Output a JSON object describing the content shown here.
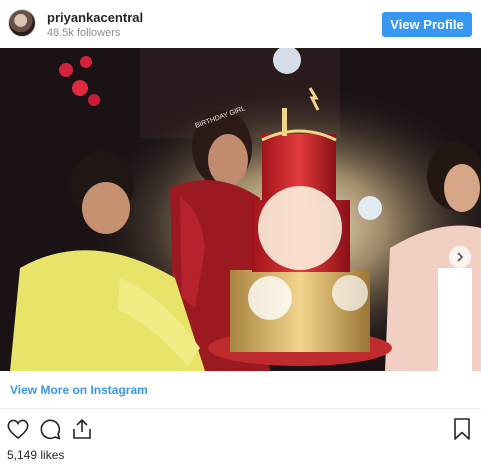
{
  "header": {
    "username": "priyankacentral",
    "followers": "48.5k followers",
    "view_profile_label": "View Profile"
  },
  "photo": {
    "cake_topper_text": "BIRTHDAY GIRL",
    "icon": "carousel-next-icon"
  },
  "footer": {
    "more_link": "View More on Instagram",
    "likes": "5,149 likes"
  },
  "colors": {
    "accent": "#3897f0",
    "text": "#262626",
    "muted": "#8e8e8e"
  },
  "icons": [
    "heart-icon",
    "comment-icon",
    "share-icon",
    "bookmark-icon"
  ]
}
